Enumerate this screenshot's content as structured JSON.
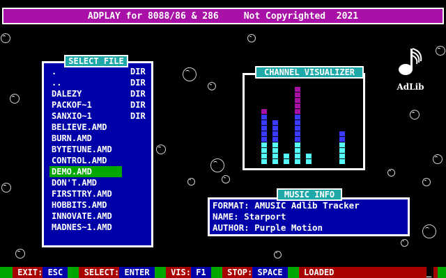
{
  "title_bar": {
    "app": "ADPLAY for 8088/86 & 286",
    "notice": "Not Copyrighted",
    "year": "2021"
  },
  "file_panel": {
    "label": "SELECT FILE",
    "selected_index": 9,
    "files": [
      {
        "name": ".",
        "type": "DIR"
      },
      {
        "name": "..",
        "type": "DIR"
      },
      {
        "name": "DALEZY",
        "type": "DIR"
      },
      {
        "name": "PACKOF~1",
        "type": "DIR"
      },
      {
        "name": "SANXIO~1",
        "type": "DIR"
      },
      {
        "name": "BELIEVE.AMD",
        "type": ""
      },
      {
        "name": "BURN.AMD",
        "type": ""
      },
      {
        "name": "BYTETUNE.AMD",
        "type": ""
      },
      {
        "name": "CONTROL.AMD",
        "type": ""
      },
      {
        "name": "DEMO.AMD",
        "type": ""
      },
      {
        "name": "DON'T.AMD",
        "type": ""
      },
      {
        "name": "FIRSTTRY.AMD",
        "type": ""
      },
      {
        "name": "HOBBITS.AMD",
        "type": ""
      },
      {
        "name": "INNOVATE.AMD",
        "type": ""
      },
      {
        "name": "MADNES~1.AMD",
        "type": ""
      }
    ]
  },
  "visualizer": {
    "label": "CHANNEL  VISUALIZER",
    "channel_levels": [
      10,
      8,
      2,
      14,
      2,
      0,
      0,
      6,
      0
    ],
    "max_level": 16,
    "colors": {
      "low": "#55ffff",
      "mid": "#3a3aff",
      "high": "#a810a8"
    }
  },
  "music_info": {
    "label": "MUSIC  INFO",
    "format_label": "FORMAT:",
    "format_value": "AMUSIC Adlib Tracker",
    "name_label": "NAME:",
    "name_value": "Starport",
    "author_label": "AUTHOR:",
    "author_value": "Purple Motion"
  },
  "logo": {
    "text": "AdLib",
    "icon": "adlib-note-icon"
  },
  "status_bar": {
    "exit_label": " EXIT:",
    "exit_key": " ESC ",
    "select_label": " SELECT:",
    "select_key": " ENTER ",
    "vis_label": " VIS:",
    "vis_key": " F1 ",
    "stop_label": " STOP:",
    "stop_key": " SPACE ",
    "status_text": " LOADED",
    "cursor": "_"
  },
  "colors": {
    "title_bg": "#a810a8",
    "panel_bg": "#0000a8",
    "label_bg": "#1ea8a8",
    "selected_bg": "#00a800",
    "status_red": "#a80000"
  }
}
